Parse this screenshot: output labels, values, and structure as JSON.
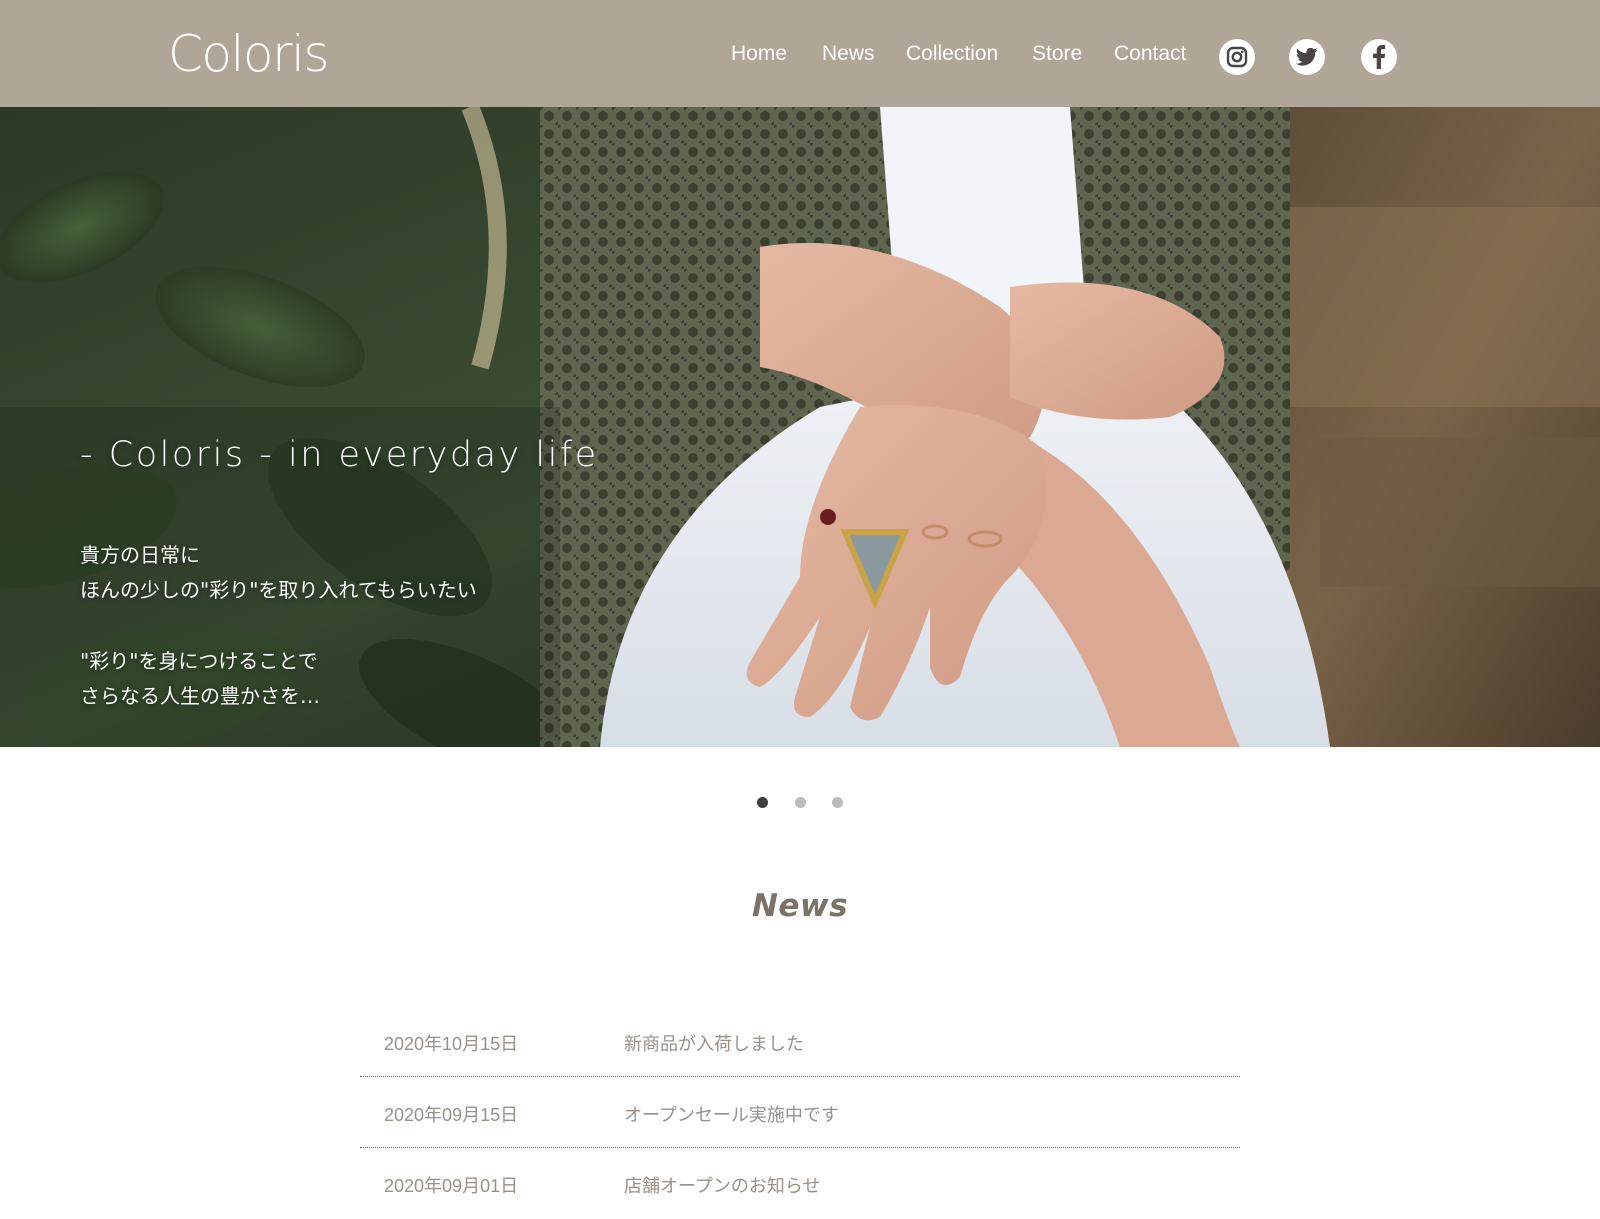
{
  "header": {
    "logo": "Coloris",
    "nav": [
      {
        "label": "Home"
      },
      {
        "label": "News"
      },
      {
        "label": "Collection"
      },
      {
        "label": "Store"
      },
      {
        "label": "Contact"
      }
    ],
    "social": [
      {
        "icon": "instagram-icon"
      },
      {
        "icon": "twitter-icon"
      },
      {
        "icon": "facebook-icon"
      }
    ],
    "background_color": "#b0a698"
  },
  "hero": {
    "tagline": "- Coloris - in everyday life",
    "copy": [
      "貴方の日常に",
      "ほんの少しの\"彩り\"を取り入れてもらいたい",
      "\"彩り\"を身につけることで",
      "さらなる人生の豊かさを…"
    ]
  },
  "slider": {
    "dots": 3,
    "active_index": 0
  },
  "news": {
    "title": "News",
    "items": [
      {
        "date": "2020年10月15日",
        "text": "新商品が入荷しました"
      },
      {
        "date": "2020年09月15日",
        "text": "オープンセール実施中です"
      },
      {
        "date": "2020年09月01日",
        "text": "店舗オープンのお知らせ"
      }
    ]
  }
}
